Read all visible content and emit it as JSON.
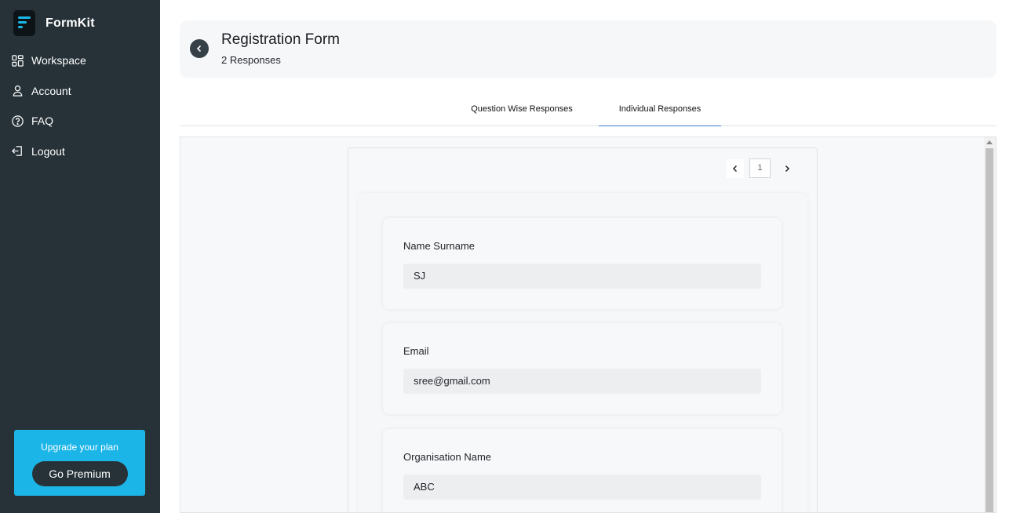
{
  "app": {
    "name": "FormKit"
  },
  "sidebar": {
    "items": [
      {
        "label": "Workspace",
        "icon": "grid-icon"
      },
      {
        "label": "Account",
        "icon": "user-icon"
      },
      {
        "label": "FAQ",
        "icon": "help-circle-icon"
      },
      {
        "label": "Logout",
        "icon": "logout-icon"
      }
    ],
    "upgrade": {
      "title": "Upgrade your plan",
      "button": "Go Premium"
    }
  },
  "header": {
    "title": "Registration Form",
    "subtitle": "2 Responses"
  },
  "tabs": [
    {
      "label": "Question Wise Responses",
      "active": false
    },
    {
      "label": "Individual Responses",
      "active": true
    }
  ],
  "pager": {
    "current": "1"
  },
  "responses": [
    {
      "question": "Name Surname",
      "answer": "SJ"
    },
    {
      "question": "Email",
      "answer": "sree@gmail.com"
    },
    {
      "question": "Organisation Name",
      "answer": "ABC"
    }
  ],
  "colors": {
    "sidebar": "#263238",
    "accent": "#1cb5e8",
    "tab_underline": "#3b79d9"
  }
}
